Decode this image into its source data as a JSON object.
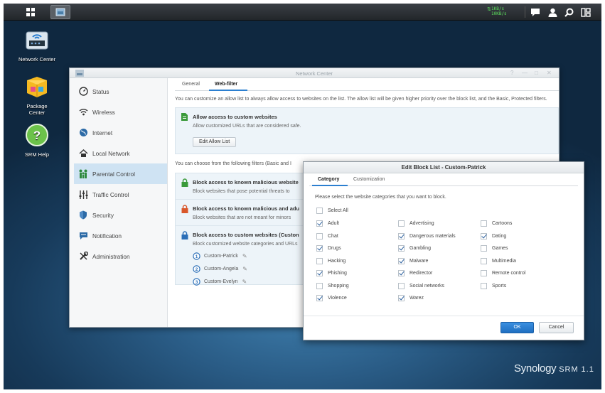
{
  "taskbar": {
    "upload_speed": "1KB/s",
    "download_speed": "10KB/s",
    "icons": [
      "main-menu-icon",
      "network-center-icon",
      "chat-icon",
      "user-icon",
      "search-icon",
      "widgets-icon"
    ]
  },
  "desktop": {
    "icons": [
      {
        "label": "Network Center"
      },
      {
        "label": "Package Center"
      },
      {
        "label": "SRM Help"
      }
    ]
  },
  "network_center": {
    "title": "Network Center",
    "sidebar": [
      {
        "label": "Status",
        "icon": "gauge-icon"
      },
      {
        "label": "Wireless",
        "icon": "wifi-icon"
      },
      {
        "label": "Internet",
        "icon": "globe-icon"
      },
      {
        "label": "Local Network",
        "icon": "house-icon"
      },
      {
        "label": "Parental Control",
        "icon": "family-icon",
        "active": true
      },
      {
        "label": "Traffic Control",
        "icon": "sliders-icon"
      },
      {
        "label": "Security",
        "icon": "shield-icon"
      },
      {
        "label": "Notification",
        "icon": "message-icon"
      },
      {
        "label": "Administration",
        "icon": "tools-icon"
      }
    ],
    "tabs": [
      "General",
      "Web-filter"
    ],
    "active_tab": "Web-filter",
    "allow_desc": "You can customize an allow list to always allow access to websites on the list. The allow list will be given higher priority over the block list, and the Basic, Protected filters.",
    "allow_title": "Allow access to custom websites",
    "allow_sub": "Allow customized URLs that are considered safe.",
    "allow_button": "Edit Allow List",
    "filter_desc": "You can choose from the following filters (Basic and I",
    "filters": [
      {
        "title": "Block access to known malicious website",
        "sub": "Block websites that pose potential threats to",
        "lock_color": "#3a9a3a"
      },
      {
        "title": "Block access to known malicious and adu",
        "sub": "Block websites that are not meant for minors",
        "lock_color": "#d9572a"
      },
      {
        "title": "Block access to custom websites (Custon",
        "sub": "Block customized website categories and URLs",
        "lock_color": "#2b6fb8"
      }
    ],
    "profiles": [
      "Custom-Patrick",
      "Custom-Angela",
      "Custom-Evelyn"
    ]
  },
  "dialog": {
    "title": "Edit Block List - Custom-Patrick",
    "tabs": [
      "Category",
      "Customization"
    ],
    "active_tab": "Category",
    "instruction": "Please select the website categories that you want to block.",
    "select_all": {
      "label": "Select All",
      "checked": false
    },
    "categories": [
      {
        "label": "Adult",
        "checked": true
      },
      {
        "label": "Advertising",
        "checked": false
      },
      {
        "label": "Cartoons",
        "checked": false
      },
      {
        "label": "Chat",
        "checked": false
      },
      {
        "label": "Dangerous materials",
        "checked": true
      },
      {
        "label": "Dating",
        "checked": true
      },
      {
        "label": "Drugs",
        "checked": true
      },
      {
        "label": "Gambling",
        "checked": true
      },
      {
        "label": "Games",
        "checked": false
      },
      {
        "label": "Hacking",
        "checked": false
      },
      {
        "label": "Malware",
        "checked": true
      },
      {
        "label": "Multimedia",
        "checked": false
      },
      {
        "label": "Phishing",
        "checked": true
      },
      {
        "label": "Redirector",
        "checked": true
      },
      {
        "label": "Remote control",
        "checked": false
      },
      {
        "label": "Shopping",
        "checked": false
      },
      {
        "label": "Social networks",
        "checked": false
      },
      {
        "label": "Sports",
        "checked": false
      },
      {
        "label": "Violence",
        "checked": true
      },
      {
        "label": "Warez",
        "checked": true
      }
    ],
    "ok_label": "OK",
    "cancel_label": "Cancel"
  },
  "brand": {
    "name": "Synology",
    "product": "SRM",
    "version": "1.1"
  }
}
